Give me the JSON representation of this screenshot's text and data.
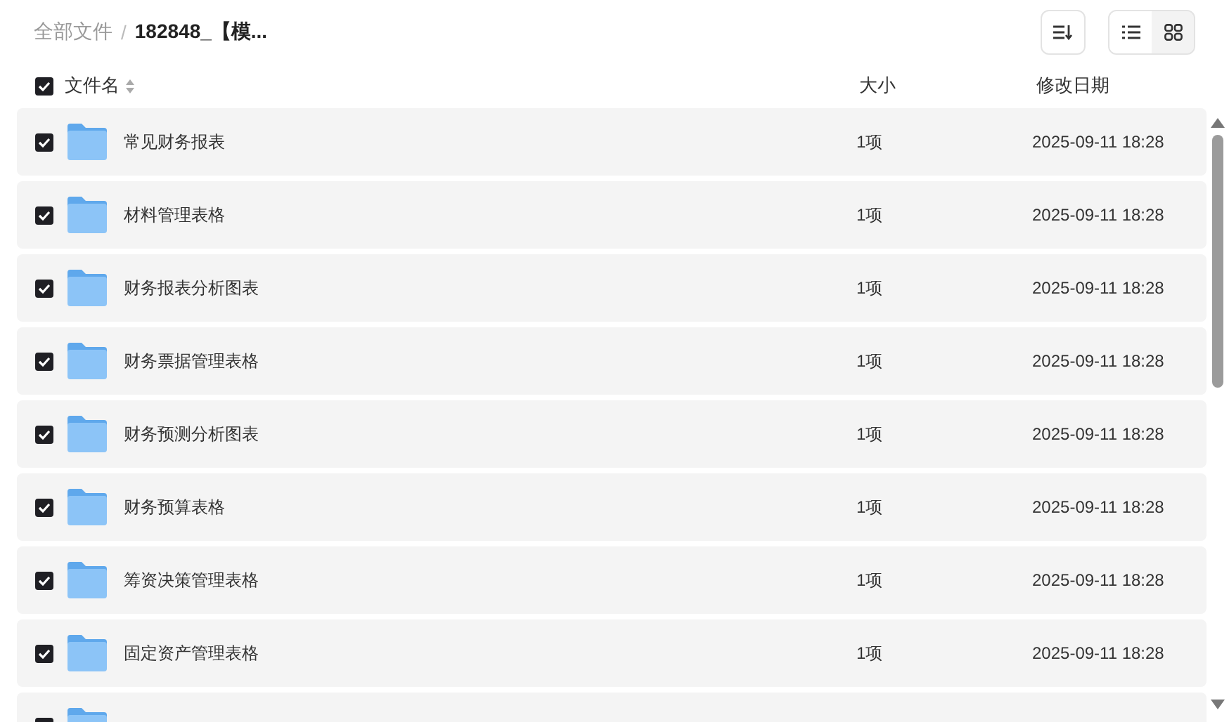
{
  "breadcrumb": [
    {
      "label": "全部文件",
      "current": false
    },
    {
      "label": "182848_【模...",
      "current": true
    }
  ],
  "breadcrumb_separator": "/",
  "view_modes": [
    {
      "kind": "list",
      "selected": true
    },
    {
      "kind": "grid",
      "selected": false
    }
  ],
  "header": {
    "checked": true,
    "columns": [
      "文件名",
      "大小",
      "修改日期"
    ]
  },
  "rows": [
    {
      "checked": true,
      "name": "常见财务报表",
      "size": "1项",
      "date": "2025-09-11 18:28"
    },
    {
      "checked": true,
      "name": "材料管理表格",
      "size": "1项",
      "date": "2025-09-11 18:28"
    },
    {
      "checked": true,
      "name": "财务报表分析图表",
      "size": "1项",
      "date": "2025-09-11 18:28"
    },
    {
      "checked": true,
      "name": "财务票据管理表格",
      "size": "1项",
      "date": "2025-09-11 18:28"
    },
    {
      "checked": true,
      "name": "财务预测分析图表",
      "size": "1项",
      "date": "2025-09-11 18:28"
    },
    {
      "checked": true,
      "name": "财务预算表格",
      "size": "1项",
      "date": "2025-09-11 18:28"
    },
    {
      "checked": true,
      "name": "筹资决策管理表格",
      "size": "1项",
      "date": "2025-09-11 18:28"
    },
    {
      "checked": true,
      "name": "固定资产管理表格",
      "size": "1项",
      "date": "2025-09-11 18:28"
    },
    {
      "checked": true
    }
  ]
}
